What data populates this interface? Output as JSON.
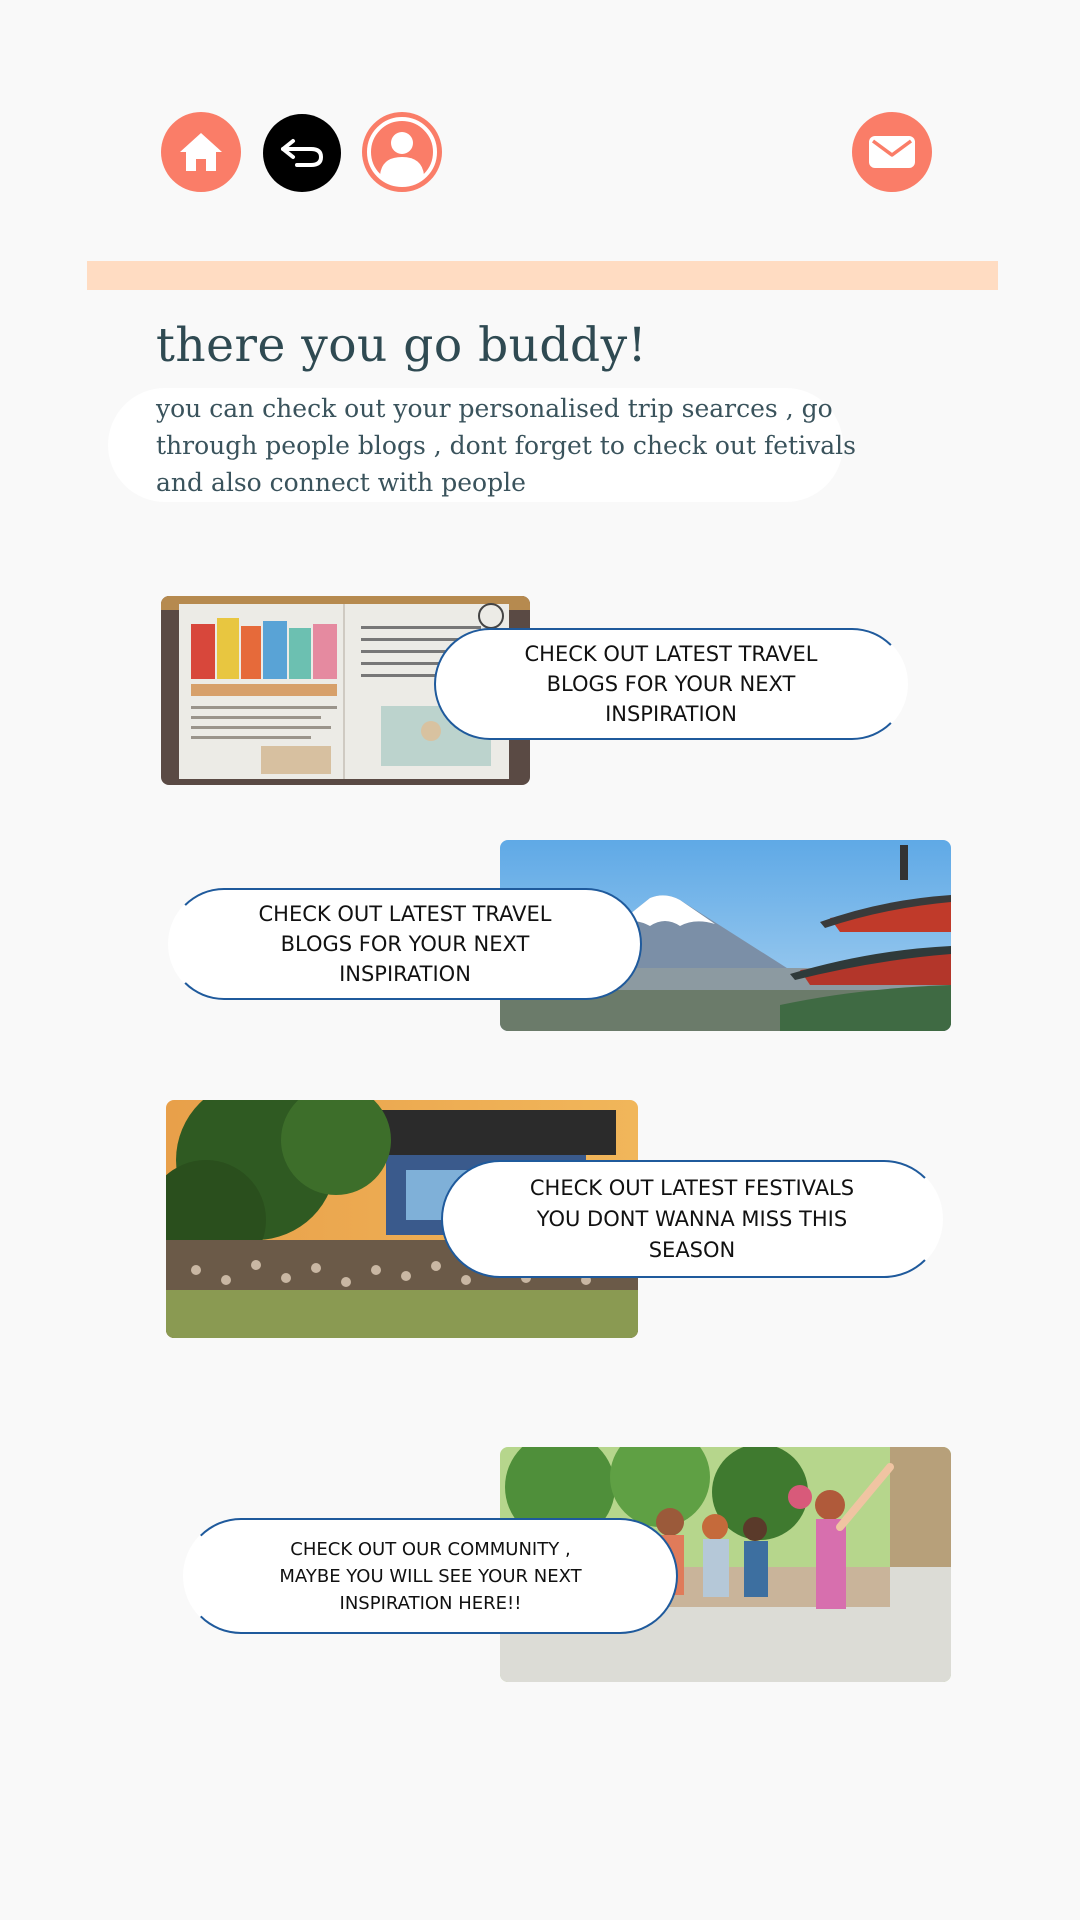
{
  "nav": {
    "home_icon": "home-icon",
    "back_icon": "back-arrow-icon",
    "profile_icon": "user-profile-icon",
    "mail_icon": "mail-icon",
    "colors": {
      "coral": "#fa7d68",
      "black": "#000000"
    }
  },
  "header": {
    "accent_bar_color": "#ffdcc2",
    "title": "there you go buddy!",
    "intro": "you can check out your personalised trip searces , go through people blogs , dont forget to check out fetivals and also connect with people"
  },
  "cards": [
    {
      "text": "CHECK OUT LATEST TRAVEL\nBLOGS FOR YOUR NEXT\nINSPIRATION",
      "image": "travel-journal-photo"
    },
    {
      "text": "CHECK OUT LATEST TRAVEL\nBLOGS FOR YOUR NEXT\nINSPIRATION",
      "image": "mount-fuji-pagoda-photo"
    },
    {
      "text": "CHECK OUT LATEST FESTIVALS\nYOU DONT WANNA MISS THIS\nSEASON",
      "image": "music-festival-crowd-photo"
    },
    {
      "text": "CHECK OUT OUR  COMMUNITY ,\nMAYBE YOU WILL SEE YOUR NEXT\nINSPIRATION HERE!!",
      "image": "travel-group-photo"
    }
  ]
}
